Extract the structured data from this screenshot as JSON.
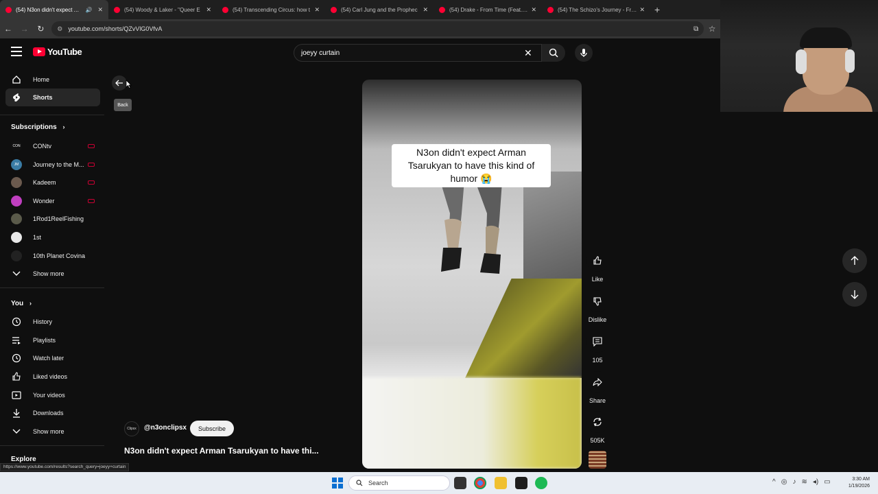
{
  "browser": {
    "tabs": [
      {
        "label": "(54) N3on didn't expect Arman",
        "active": true,
        "audio": true
      },
      {
        "label": "(54) Woody & Laker - \"Queer E",
        "active": false
      },
      {
        "label": "(54) Transcending Circus: how t",
        "active": false
      },
      {
        "label": "(54) Carl Jung and the Prophec",
        "active": false
      },
      {
        "label": "(54) Drake - From Time (Feat. Je",
        "active": false
      },
      {
        "label": "(54) The Schizo's Journey - From",
        "active": false
      }
    ],
    "url": "youtube.com/shorts/QZvVlG0VfvA",
    "status_url": "https://www.youtube.com/results?search_query=joeyy+curtain"
  },
  "header": {
    "logo_text": "YouTube",
    "search_value": "joeyy curtain"
  },
  "sidebar": {
    "main": [
      {
        "label": "Home",
        "icon": "home-icon"
      },
      {
        "label": "Shorts",
        "icon": "shorts-icon",
        "active": true
      }
    ],
    "subscriptions_heading": "Subscriptions",
    "subscriptions": [
      {
        "label": "CONtv",
        "avatar_color": "#111111",
        "avatar_text": "CON",
        "live": true
      },
      {
        "label": "Journey to the M...",
        "avatar_color": "#3a7ca5",
        "avatar_text": "JM",
        "live": true
      },
      {
        "label": "Kadeem",
        "avatar_color": "#6b5a4e",
        "avatar_text": "",
        "live": true
      },
      {
        "label": "Wonder",
        "avatar_color": "#c03fc0",
        "avatar_text": "",
        "live": true
      },
      {
        "label": "1Rod1ReelFishing",
        "avatar_color": "#5a5a4a",
        "avatar_text": "",
        "live": false
      },
      {
        "label": "1st",
        "avatar_color": "#e8e8e8",
        "avatar_text": "",
        "live": false
      },
      {
        "label": "10th Planet Covina",
        "avatar_color": "#222222",
        "avatar_text": "",
        "live": false
      }
    ],
    "show_more_1": "Show more",
    "you_heading": "You",
    "you_items": [
      {
        "label": "History",
        "icon": "history-icon"
      },
      {
        "label": "Playlists",
        "icon": "playlists-icon"
      },
      {
        "label": "Watch later",
        "icon": "watch-later-icon"
      },
      {
        "label": "Liked videos",
        "icon": "liked-videos-icon"
      },
      {
        "label": "Your videos",
        "icon": "your-videos-icon"
      },
      {
        "label": "Downloads",
        "icon": "downloads-icon"
      }
    ],
    "show_more_2": "Show more",
    "explore_heading": "Explore"
  },
  "back": {
    "tooltip": "Back"
  },
  "short": {
    "caption": "N3on didn't expect Arman Tsarukyan to have this kind of humor 😭",
    "channel_avatar_text": "Clipsx",
    "channel": "@n3onclipsx",
    "subscribe": "Subscribe",
    "title": "N3on didn't expect Arman Tsarukyan to have thi..."
  },
  "actions": {
    "like": "Like",
    "dislike": "Dislike",
    "comments": "105",
    "share": "Share",
    "remix": "505K"
  },
  "taskbar": {
    "search": "Search",
    "time": "3:30 AM",
    "date": "1/19/2026"
  }
}
